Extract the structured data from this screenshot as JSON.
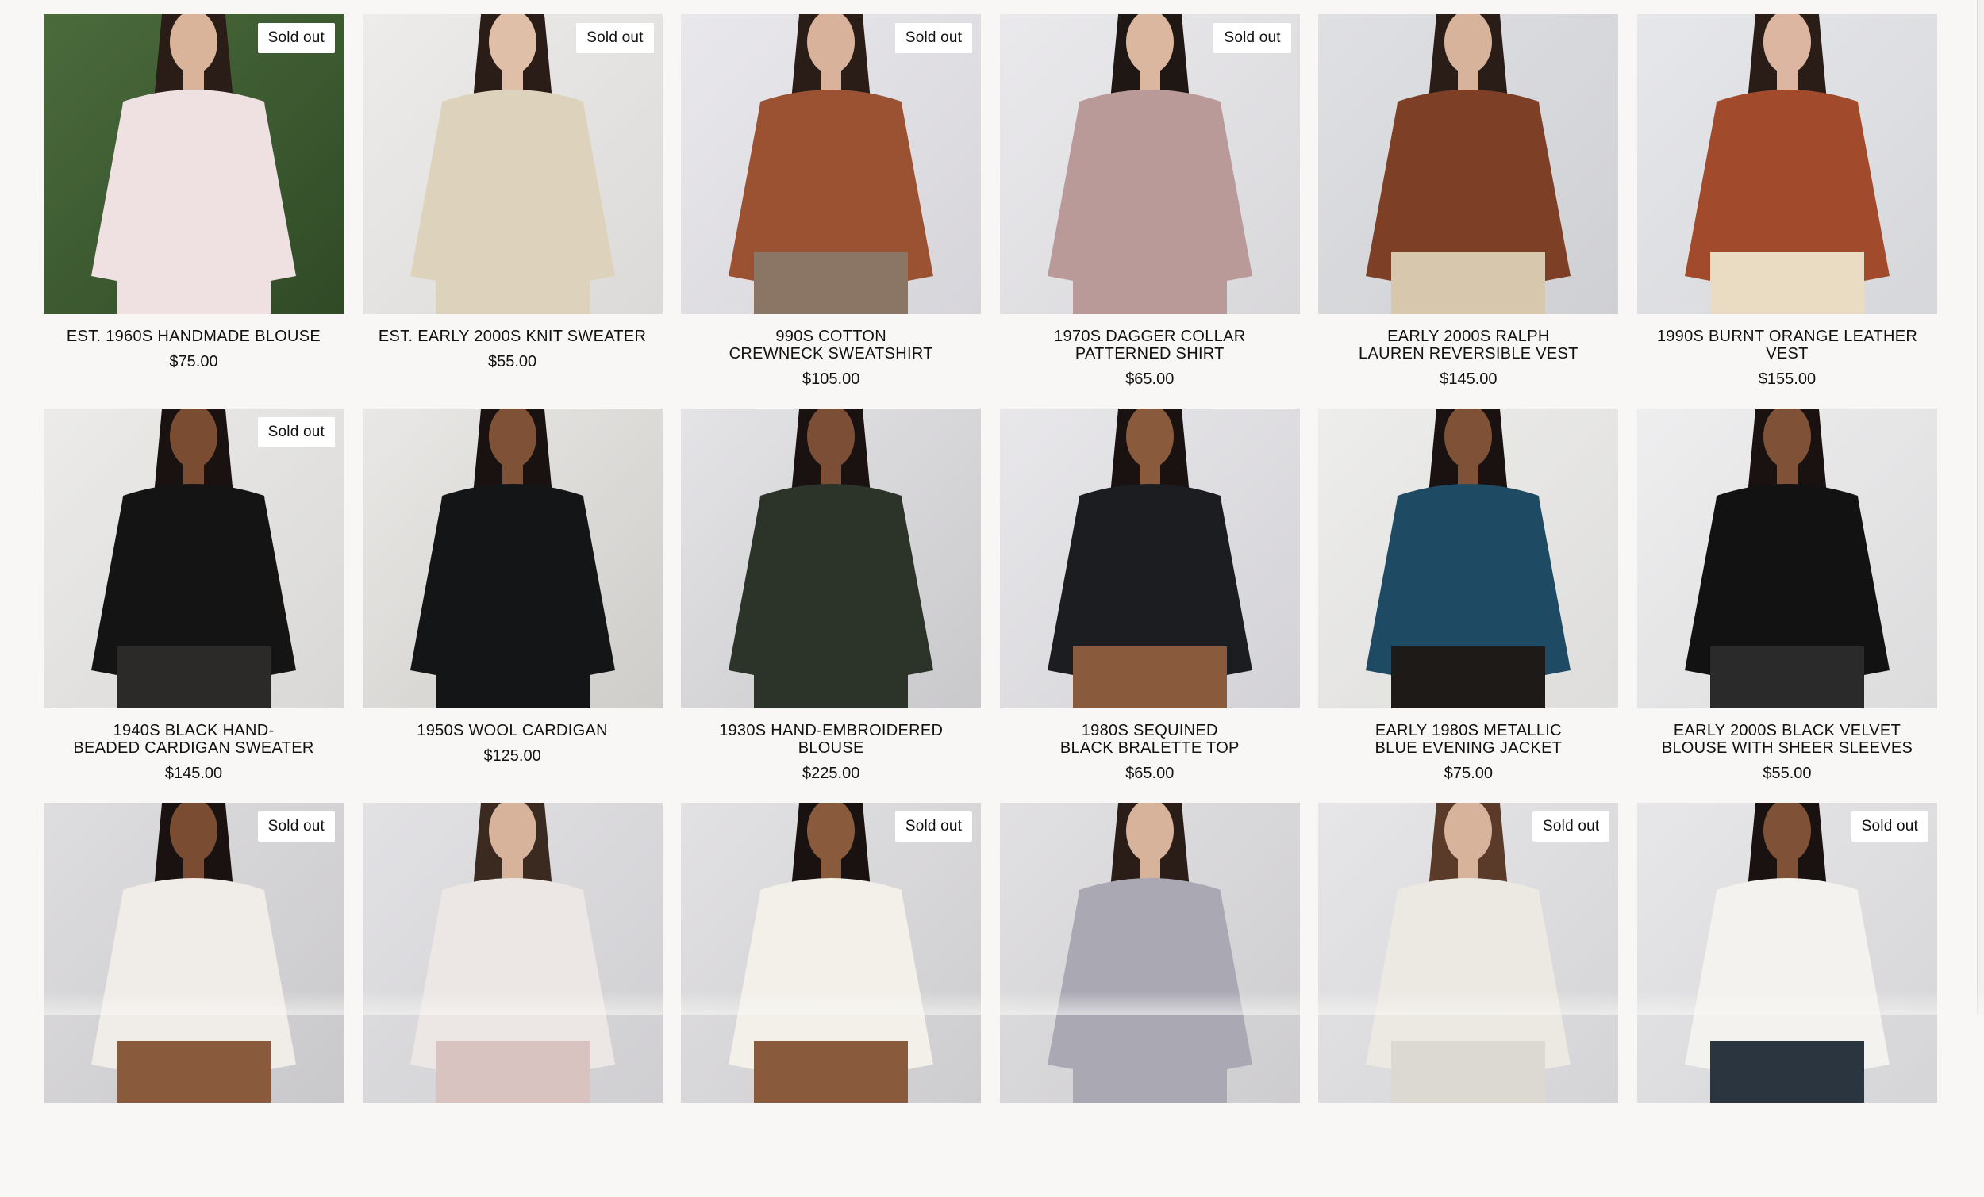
{
  "products": [
    {
      "title": "EST. 1960S HANDMADE BLOUSE",
      "price": "$75.00",
      "badge": "Sold out",
      "palette": {
        "bg": "#4b6b3c",
        "bg2": "#2f4a26",
        "garment": "#efe1e1",
        "skin": "#d9b49a",
        "hair": "#2a1c17",
        "bottom": "#efe1e1"
      }
    },
    {
      "title": "EST. EARLY 2000S KNIT SWEATER",
      "price": "$55.00",
      "badge": "Sold out",
      "palette": {
        "bg": "#eeeceb",
        "bg2": "#dcdad8",
        "garment": "#ddd3bd",
        "skin": "#e0bfa8",
        "hair": "#2a1c17",
        "bottom": "#ddd3bd"
      }
    },
    {
      "title": "990S COTTON\nCREWNECK SWEATSHIRT",
      "price": "$105.00",
      "badge": "Sold out",
      "palette": {
        "bg": "#e9e8ec",
        "bg2": "#d6d5da",
        "garment": "#9b5232",
        "skin": "#d8b29a",
        "hair": "#2a1c17",
        "bottom": "#8b7666"
      }
    },
    {
      "title": "1970S DAGGER COLLAR\nPATTERNED SHIRT",
      "price": "$65.00",
      "badge": "Sold out",
      "palette": {
        "bg": "#eae9ec",
        "bg2": "#d8d7da",
        "garment": "#b99a98",
        "skin": "#dcb7a0",
        "hair": "#1f1713",
        "bottom": "#b99a98"
      }
    },
    {
      "title": "EARLY 2000S RALPH\nLAUREN REVERSIBLE VEST",
      "price": "$145.00",
      "badge": "",
      "palette": {
        "bg": "#dfe0e3",
        "bg2": "#cfd0d3",
        "garment": "#7d3f26",
        "skin": "#d8b39b",
        "hair": "#2a1c17",
        "bottom": "#d7c8ad"
      }
    },
    {
      "title": "1990S BURNT ORANGE LEATHER VEST",
      "price": "$155.00",
      "badge": "",
      "palette": {
        "bg": "#e6e7ea",
        "bg2": "#d6d7da",
        "garment": "#a14a2c",
        "skin": "#dcb6a0",
        "hair": "#2a1c17",
        "bottom": "#eadcc3"
      }
    },
    {
      "title": "1940S BLACK HAND-\nBEADED CARDIGAN SWEATER",
      "price": "$145.00",
      "badge": "Sold out",
      "palette": {
        "bg": "#ecebea",
        "bg2": "#d9d8d6",
        "garment": "#141414",
        "skin": "#7a4d33",
        "hair": "#1a1210",
        "bottom": "#2b2a28"
      }
    },
    {
      "title": "1950S WOOL CARDIGAN",
      "price": "$125.00",
      "badge": "",
      "palette": {
        "bg": "#e9e8e6",
        "bg2": "#cfcdca",
        "garment": "#141516",
        "skin": "#7f5136",
        "hair": "#1a1210",
        "bottom": "#141516"
      }
    },
    {
      "title": "1930S HAND-EMBROIDERED BLOUSE",
      "price": "$225.00",
      "badge": "",
      "palette": {
        "bg": "#e4e3e6",
        "bg2": "#c9c8cb",
        "garment": "#2c3328",
        "skin": "#7b4e35",
        "hair": "#1a1210",
        "bottom": "#2c3328"
      }
    },
    {
      "title": "1980S SEQUINED\nBLACK BRALETTE TOP",
      "price": "$65.00",
      "badge": "",
      "palette": {
        "bg": "#e8e7ea",
        "bg2": "#d3d2d6",
        "garment": "#1c1d20",
        "skin": "#8a5a3d",
        "hair": "#1a1210",
        "bottom": "#8a5a3d"
      }
    },
    {
      "title": "EARLY 1980S METALLIC\nBLUE EVENING JACKET",
      "price": "$75.00",
      "badge": "",
      "palette": {
        "bg": "#ededeb",
        "bg2": "#dedddb",
        "garment": "#1f4a63",
        "skin": "#7f5136",
        "hair": "#1a1210",
        "bottom": "#1d1a17"
      }
    },
    {
      "title": "EARLY 2000S BLACK VELVET\nBLOUSE WITH SHEER SLEEVES",
      "price": "$55.00",
      "badge": "",
      "palette": {
        "bg": "#eeeeef",
        "bg2": "#dcdcdd",
        "garment": "#121212",
        "skin": "#7f5136",
        "hair": "#1a1210",
        "bottom": "#2a2a2a"
      }
    },
    {
      "title": "",
      "price": "",
      "badge": "Sold out",
      "palette": {
        "bg": "#dedddf",
        "bg2": "#c9c8ca",
        "garment": "#f0ece8",
        "skin": "#7a4d33",
        "hair": "#1a1210",
        "bottom": "#8a5a3d"
      }
    },
    {
      "title": "",
      "price": "",
      "badge": "",
      "palette": {
        "bg": "#e2e1e4",
        "bg2": "#cfced1",
        "garment": "#ece6e4",
        "skin": "#d8b39b",
        "hair": "#3a2a20",
        "bottom": "#d8c3c1"
      }
    },
    {
      "title": "",
      "price": "",
      "badge": "Sold out",
      "palette": {
        "bg": "#e2e1e3",
        "bg2": "#cdccce",
        "garment": "#f3f0ea",
        "skin": "#8a5a3d",
        "hair": "#1a1210",
        "bottom": "#8a5a3d"
      }
    },
    {
      "title": "",
      "price": "",
      "badge": "",
      "palette": {
        "bg": "#e1e0e2",
        "bg2": "#cdccce",
        "garment": "#a9a8b3",
        "skin": "#d8b39b",
        "hair": "#2a1c17",
        "bottom": "#a9a8b3"
      }
    },
    {
      "title": "",
      "price": "",
      "badge": "Sold out",
      "palette": {
        "bg": "#e6e6e8",
        "bg2": "#d4d4d6",
        "garment": "#ece8e2",
        "skin": "#d8b39b",
        "hair": "#5a3a28",
        "bottom": "#dcd8d2"
      }
    },
    {
      "title": "",
      "price": "",
      "badge": "Sold out",
      "palette": {
        "bg": "#e7e7e9",
        "bg2": "#d5d5d7",
        "garment": "#f4f2ee",
        "skin": "#7f5136",
        "hair": "#1a1210",
        "bottom": "#2a3540"
      }
    }
  ]
}
